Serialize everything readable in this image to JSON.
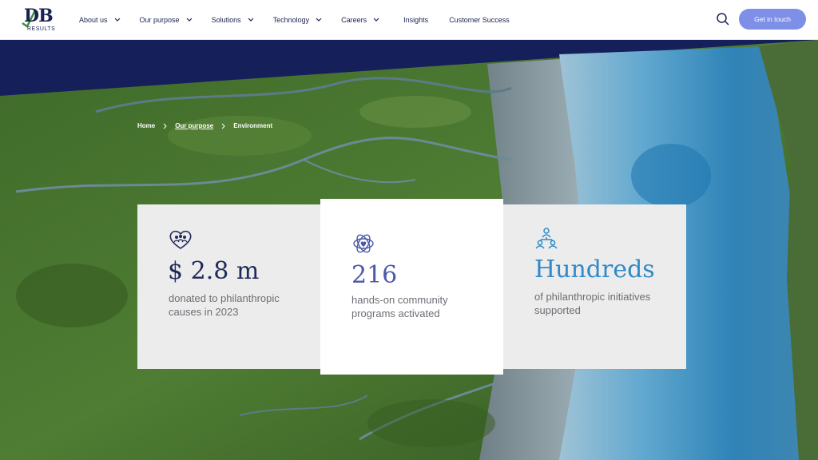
{
  "header": {
    "logo_text": "DB",
    "logo_subtext": "RESULTS",
    "nav": [
      {
        "label": "About us",
        "has_dropdown": true
      },
      {
        "label": "Our purpose",
        "has_dropdown": true
      },
      {
        "label": "Solutions",
        "has_dropdown": true
      },
      {
        "label": "Technology",
        "has_dropdown": true
      },
      {
        "label": "Careers",
        "has_dropdown": true
      },
      {
        "label": "Insights",
        "has_dropdown": false
      },
      {
        "label": "Customer Success",
        "has_dropdown": false
      }
    ],
    "search_icon": "search-icon",
    "cta_label": "Get in touch"
  },
  "breadcrumb": {
    "items": [
      "Home",
      "Our purpose",
      "Environment"
    ]
  },
  "stats": [
    {
      "icon": "heart-people-icon",
      "value": "$ 2.8 m",
      "description": "donated to philanthropic causes in 2023"
    },
    {
      "icon": "flower-heart-icon",
      "value": "216",
      "description": "hands-on community programs activated"
    },
    {
      "icon": "people-network-icon",
      "value": "Hundreds",
      "description": "of philanthropic initiatives supported"
    }
  ],
  "colors": {
    "navy": "#1a2150",
    "cta": "#7e8fe8",
    "accent_blue": "#2f8ac7",
    "hero_top": "#15205a"
  }
}
